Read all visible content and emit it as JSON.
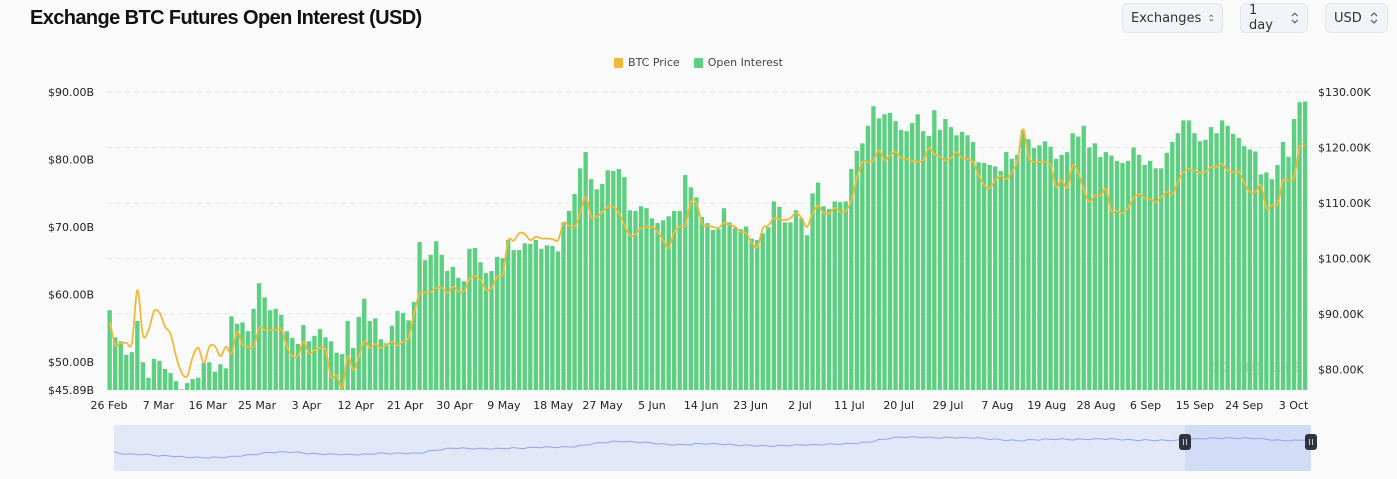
{
  "header": {
    "title": "Exchange BTC Futures Open Interest (USD)"
  },
  "controls": [
    {
      "label": "Exchanges",
      "icon": "chevron-up-down-icon"
    },
    {
      "label": "1 day",
      "icon": "chevron-up-down-icon"
    },
    {
      "label": "USD",
      "icon": "chevron-up-down-icon"
    }
  ],
  "watermark": "coinglass",
  "colors": {
    "price": "#f0b93b",
    "oi": "#5dcf80",
    "navigator_line": "#8fa6ea",
    "navigator_fill": "#e3e8f8",
    "navigator_selected": "#d3dcf6",
    "handle": "#2f3440"
  },
  "chart_data": {
    "type": "bar+line",
    "title": "Exchange BTC Futures Open Interest (USD)",
    "legend": {
      "placement": "top-center",
      "entries": [
        "BTC Price",
        "Open Interest"
      ]
    },
    "x_start": "26 Feb",
    "x_ticks": [
      "26 Feb",
      "7 Mar",
      "16 Mar",
      "25 Mar",
      "3 Apr",
      "12 Apr",
      "21 Apr",
      "30 Apr",
      "9 May",
      "18 May",
      "27 May",
      "5 Jun",
      "14 Jun",
      "23 Jun",
      "2 Jul",
      "11 Jul",
      "20 Jul",
      "29 Jul",
      "7 Aug",
      "19 Aug",
      "28 Aug",
      "6 Sep",
      "15 Sep",
      "24 Sep",
      "3 Oct"
    ],
    "y_left": {
      "unit": "USD billions",
      "range": [
        45.89,
        90
      ],
      "ticks": [
        "$90.00B",
        "$80.00B",
        "$70.00B",
        "$60.00B",
        "$50.00B",
        "$45.89B"
      ],
      "tick_values": [
        90,
        80,
        70,
        60,
        50,
        45.89
      ]
    },
    "y_right": {
      "unit": "USD thousands",
      "range": [
        76.3,
        130
      ],
      "ticks": [
        "$130.00K",
        "$120.00K",
        "$110.00K",
        "$100.00K",
        "$90.00K",
        "$80.00K"
      ],
      "tick_values": [
        130,
        120,
        110,
        100,
        90,
        80
      ]
    },
    "grid": true,
    "series": [
      {
        "name": "Open Interest",
        "type": "bar",
        "axis": "left",
        "values": [
          57.7,
          53.7,
          53.1,
          51.1,
          51.5,
          56.1,
          50.0,
          47.7,
          50.5,
          50.2,
          49.0,
          48.4,
          47.2,
          46.0,
          46.9,
          47.5,
          47.7,
          49.9,
          50.0,
          48.6,
          49.7,
          49.1,
          56.8,
          55.7,
          55.9,
          54.6,
          57.9,
          61.7,
          59.6,
          57.7,
          57.9,
          57.0,
          54.6,
          53.6,
          52.7,
          55.5,
          53.1,
          53.9,
          54.9,
          53.7,
          53.1,
          51.4,
          51.2,
          56.1,
          52.1,
          56.7,
          59.4,
          56.1,
          56.5,
          53.4,
          52.8,
          55.4,
          57.6,
          57.3,
          56.2,
          58.9,
          67.8,
          65.1,
          65.9,
          67.9,
          65.9,
          63.5,
          64.1,
          62.5,
          62.0,
          66.8,
          66.9,
          64.8,
          63.2,
          63.5,
          65.6,
          65.4,
          68.1,
          66.6,
          66.6,
          67.6,
          67.5,
          68.1,
          66.8,
          67.3,
          67.2,
          66.4,
          70.7,
          72.4,
          74.9,
          78.7,
          81.1,
          77.1,
          75.6,
          76.4,
          78.4,
          78.3,
          78.6,
          77.4,
          72.5,
          72.4,
          73.1,
          72.8,
          71.3,
          70.6,
          71.0,
          71.6,
          72.4,
          72.4,
          77.7,
          75.9,
          74.4,
          71.5,
          70.6,
          69.6,
          69.7,
          72.8,
          70.7,
          69.9,
          69.7,
          70.1,
          68.3,
          68.1,
          69.1,
          70.0,
          73.8,
          73.0,
          70.7,
          70.7,
          72.5,
          71.3,
          68.8,
          75.0,
          76.6,
          73.1,
          72.7,
          73.8,
          73.7,
          73.8,
          78.6,
          81.3,
          82.4,
          85.0,
          87.9,
          86.1,
          86.7,
          86.9,
          85.7,
          84.4,
          84.2,
          85.4,
          86.7,
          84.2,
          83.5,
          87.3,
          84.4,
          86.0,
          84.8,
          83.6,
          84.1,
          83.6,
          82.6,
          79.6,
          79.5,
          79.2,
          79.0,
          78.3,
          81.1,
          80.1,
          80.7,
          84.4,
          83.0,
          81.7,
          82.1,
          82.7,
          81.9,
          80.1,
          80.7,
          81.1,
          83.9,
          83.4,
          85.0,
          81.8,
          82.4,
          80.4,
          81.1,
          80.6,
          79.8,
          79.5,
          79.8,
          81.8,
          80.7,
          79.2,
          79.8,
          78.7,
          78.7,
          81.0,
          82.6,
          83.9,
          85.8,
          85.8,
          83.9,
          82.7,
          82.9,
          84.8,
          83.9,
          85.8,
          85.0,
          83.8,
          83.2,
          82.0,
          81.5,
          81.2,
          77.8,
          78.1,
          77.1,
          79.2,
          82.6,
          80.4,
          86.0,
          88.5,
          88.6
        ]
      },
      {
        "name": "BTC Price",
        "type": "line",
        "axis": "right",
        "values": [
          88.6,
          84.4,
          84.8,
          84.8,
          84.8,
          94.3,
          86.2,
          87.1,
          90.5,
          90.2,
          87.7,
          86.4,
          82.3,
          79.4,
          78.8,
          82.3,
          83.9,
          81.2,
          84.1,
          84.2,
          82.4,
          84.1,
          82.9,
          86.8,
          84.4,
          84.1,
          84.1,
          87.5,
          87.1,
          87.1,
          87.1,
          87.3,
          84.1,
          82.4,
          82.4,
          85.0,
          82.9,
          83.5,
          83.9,
          83.5,
          78.6,
          79.0,
          76.7,
          82.4,
          79.9,
          82.3,
          85.1,
          83.9,
          84.6,
          83.9,
          84.4,
          85.0,
          84.4,
          85.0,
          85.7,
          90.2,
          93.8,
          93.8,
          94.0,
          94.7,
          94.7,
          93.8,
          94.9,
          94.1,
          94.1,
          96.3,
          96.8,
          96.1,
          94.3,
          94.7,
          96.7,
          97.2,
          103.2,
          103.2,
          104.6,
          104.4,
          103.3,
          103.9,
          103.6,
          103.6,
          103.5,
          103.3,
          106.4,
          105.9,
          105.7,
          108.2,
          111.1,
          107.5,
          107.5,
          108.4,
          109.3,
          109.3,
          108.2,
          106.0,
          104.1,
          104.4,
          105.5,
          105.7,
          105.7,
          104.8,
          103.3,
          101.9,
          104.8,
          105.7,
          106.0,
          110.2,
          110.0,
          106.4,
          105.9,
          105.7,
          105.5,
          106.4,
          106.0,
          105.7,
          104.8,
          104.6,
          102.8,
          102.1,
          105.4,
          106.0,
          107.3,
          107.1,
          106.9,
          107.3,
          108.2,
          107.3,
          105.7,
          108.2,
          109.5,
          108.2,
          108.2,
          109.1,
          108.4,
          108.6,
          110.5,
          114.5,
          117.4,
          117.4,
          117.7,
          119.5,
          117.7,
          118.6,
          119.2,
          118.1,
          117.9,
          117.6,
          117.4,
          117.7,
          119.9,
          118.8,
          118.3,
          117.7,
          118.1,
          119.2,
          118.1,
          117.9,
          117.4,
          115.0,
          113.2,
          112.7,
          114.1,
          114.9,
          114.3,
          115.6,
          117.7,
          123.3,
          118.3,
          117.4,
          117.4,
          117.4,
          116.8,
          112.9,
          114.1,
          112.7,
          116.8,
          115.4,
          112.3,
          110.2,
          111.4,
          111.3,
          112.5,
          108.4,
          108.6,
          108.2,
          109.1,
          110.9,
          111.6,
          110.9,
          110.7,
          110.2,
          111.1,
          112.0,
          111.6,
          113.8,
          115.6,
          116.1,
          115.8,
          115.4,
          115.6,
          116.5,
          116.5,
          117.0,
          115.8,
          115.6,
          115.6,
          113.6,
          112.0,
          112.0,
          113.2,
          109.1,
          109.6,
          109.8,
          114.1,
          114.1,
          114.7,
          120.1,
          120.5
        ]
      }
    ]
  }
}
